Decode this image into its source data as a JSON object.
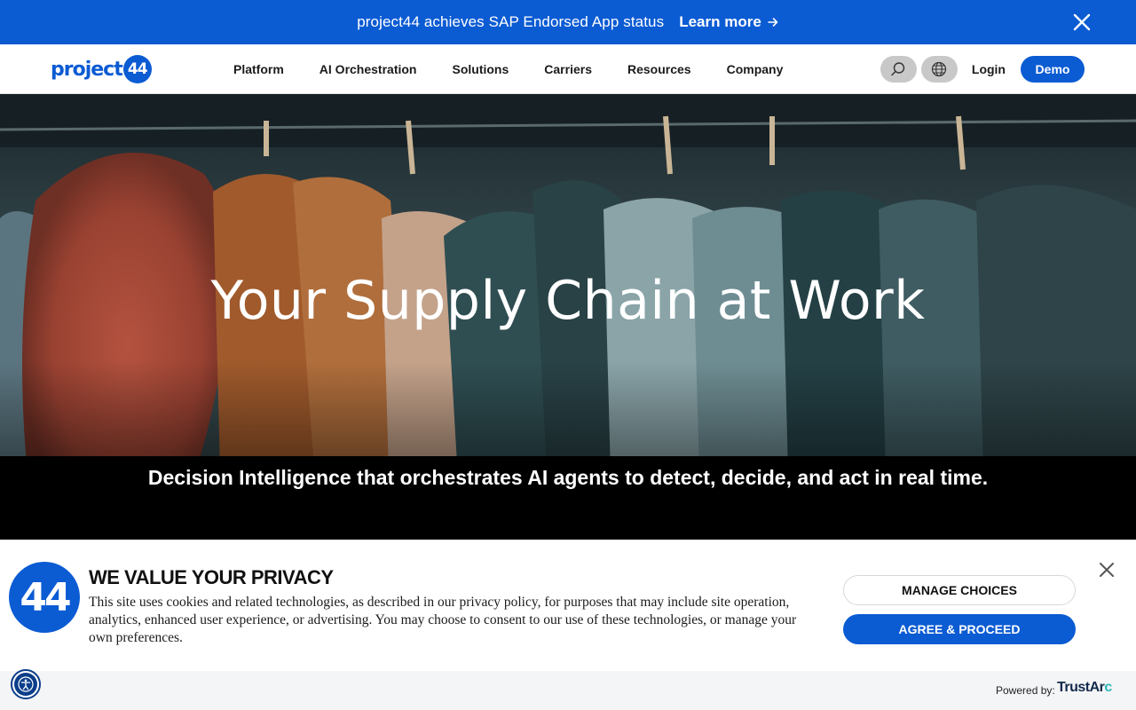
{
  "announcement": {
    "text": "project44 achieves SAP Endorsed App status",
    "link_label": "Learn more",
    "link_icon": "arrow-right-icon",
    "close_icon": "close-icon"
  },
  "nav": {
    "logo_text": "project",
    "logo_badge": "44",
    "links": [
      "Platform",
      "AI Orchestration",
      "Solutions",
      "Carriers",
      "Resources",
      "Company"
    ],
    "search_icon": "search-icon",
    "globe_icon": "globe-icon",
    "login_label": "Login",
    "demo_label": "Demo"
  },
  "hero": {
    "title": "Your Supply Chain at Work",
    "subtitle": "Decision Intelligence that orchestrates AI agents to detect, decide, and act in real time."
  },
  "cookie_banner": {
    "logo_text": "44",
    "title": "WE VALUE YOUR PRIVACY",
    "body": "This site uses cookies and related technologies, as described in our privacy policy, for purposes that may include site operation, analytics, enhanced user experience, or advertising. You may choose to consent to our use of these technologies, or manage your own preferences.",
    "manage_label": "MANAGE CHOICES",
    "agree_label": "AGREE & PROCEED",
    "close_icon": "close-icon"
  },
  "footer": {
    "powered_label": "Powered by:",
    "trustarc_main": "TrustAr",
    "trustarc_accent": "c",
    "accessibility_icon": "accessibility-icon"
  },
  "colors": {
    "brand_blue": "#0b5bd3",
    "hero_band": "#000000",
    "footer_bg": "#f4f5f7"
  }
}
